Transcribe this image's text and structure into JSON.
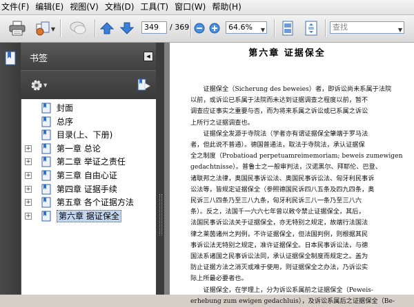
{
  "menu": [
    "文件(F)",
    "编辑(E)",
    "视图(V)",
    "文档(D)",
    "工具(T)",
    "窗口(W)",
    "帮助(H)"
  ],
  "toolbar": {
    "page_current": "349",
    "page_total": "/ 369",
    "zoom": "64.6%",
    "search_placeholder": "查找"
  },
  "sidebar": {
    "title": "书签",
    "bookmarks": [
      {
        "label": "封面",
        "expandable": false,
        "selected": false
      },
      {
        "label": "总序",
        "expandable": false,
        "selected": false
      },
      {
        "label": "目录(上、下册)",
        "expandable": false,
        "selected": false
      },
      {
        "label": "第一章 总论",
        "expandable": true,
        "selected": false
      },
      {
        "label": "第二章 举证之责任",
        "expandable": true,
        "selected": false
      },
      {
        "label": "第三章 自由心证",
        "expandable": true,
        "selected": false
      },
      {
        "label": "第四章 证据手续",
        "expandable": true,
        "selected": false
      },
      {
        "label": "第五章 各个证据方法",
        "expandable": true,
        "selected": false
      },
      {
        "label": "第六章 据证保全",
        "expandable": true,
        "selected": true
      }
    ]
  },
  "document": {
    "chapter_title": "第六章  证据保全",
    "paragraphs": [
      [
        "证据保全（Sicherung des beweies）者，即诉讼尚未系属于法院",
        "以前，或诉讼已系属于法院而未达到证据调查之程度以前，暂不",
        "调查应证事实之重要与否，而为将来系属之诉讼或已系属之诉讼",
        "上所行之证据调查也。"
      ],
      [
        "证据保全发源于寺院法（学者亦有谓证据保全肇端于罗马法",
        "者，但此说不普通）。德国普通法，取法于寺院法，承认证据保",
        "全之制度（Probatioad perpetuamreimemoriam; beweis zumewigen",
        "gedachtnisse）。普鲁士之一般审判法，汉诺黑尔、拜耶伦、巴登、",
        "诸联邦之法律，奥国民事诉讼法、奥国民事诉讼法、匈牙利民事诉",
        "讼法等，皆规定证据保全（参照德国民诉四八五条及四九四条，奥",
        "民诉三八四条乃至三八九条，匈牙利民诉三八一条乃至三八六",
        "条）。反之，法国千一六六七年曾以敕令禁止证据保全，其后，",
        "法国民事诉讼法关于证据保全，亦无特别之规定，故端行法国法",
        "律之莱茵诸州之判例，不许证据保全，但法国判例，则根据其民",
        "事诉讼法无特别之规定，准许证据保全。日本民事诉讼法，与德",
        "国法系诸国之民事诉讼法同，承认证据保全制度而规定之。盖为",
        "防止证据方法之消灭或难于使用，则证据保全之办法，乃诉讼实",
        "际上所最必要者也。"
      ],
      [
        "证据保全，在学理上，分为诉讼系属前之证据保全（Peweis-",
        "erhebung zum ewigen gedachluis），及诉讼系属后之证据保全（Be-"
      ]
    ]
  }
}
